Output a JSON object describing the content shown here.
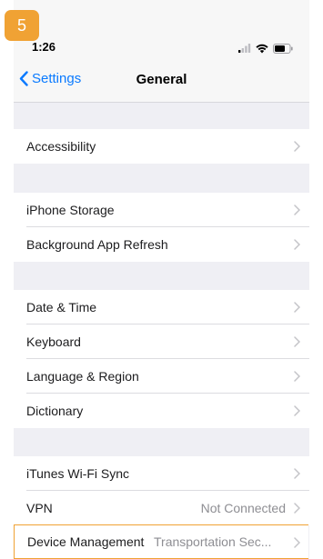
{
  "step_badge": "5",
  "status_bar": {
    "time": "1:26"
  },
  "nav": {
    "back_label": "Settings",
    "title": "General"
  },
  "colors": {
    "accent": "#0a7aff",
    "highlight": "#f0a234",
    "group_bg": "#efeff4"
  },
  "rows": {
    "accessibility": {
      "label": "Accessibility"
    },
    "iphone_storage": {
      "label": "iPhone Storage"
    },
    "background_refresh": {
      "label": "Background App Refresh"
    },
    "date_time": {
      "label": "Date & Time"
    },
    "keyboard": {
      "label": "Keyboard"
    },
    "language_region": {
      "label": "Language & Region"
    },
    "dictionary": {
      "label": "Dictionary"
    },
    "itunes_sync": {
      "label": "iTunes Wi-Fi Sync"
    },
    "vpn": {
      "label": "VPN",
      "value": "Not Connected"
    },
    "device_management": {
      "label": "Device Management",
      "value": "Transportation Sec..."
    }
  }
}
